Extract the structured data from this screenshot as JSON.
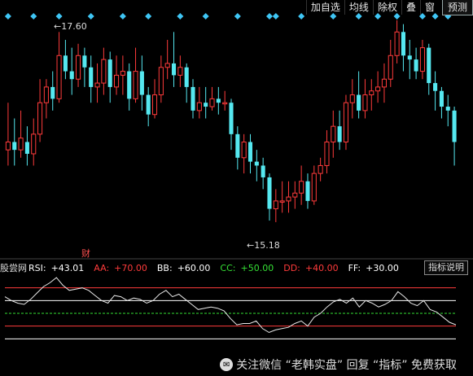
{
  "toolbar": {
    "items": [
      "加自选",
      "均线",
      "除权",
      "叠",
      "窗",
      "预测"
    ]
  },
  "price_chart": {
    "high_label": "17.60",
    "low_label": "15.18",
    "event_label": "财",
    "colors": {
      "up": "#ff3b3b",
      "down": "#55e8f0",
      "diamond": "#3fc6f5",
      "background": "#000000"
    }
  },
  "indicator": {
    "source": "股尝网",
    "items": [
      {
        "label": "RSI:",
        "value": "+43.01",
        "color": "#ffffff"
      },
      {
        "label": "AA:",
        "value": "+70.00",
        "color": "#ff3b3b"
      },
      {
        "label": "BB:",
        "value": "+60.00",
        "color": "#ffffff"
      },
      {
        "label": "CC:",
        "value": "+50.00",
        "color": "#35e035"
      },
      {
        "label": "DD:",
        "value": "+40.00",
        "color": "#ff3b3b"
      },
      {
        "label": "FF:",
        "value": "+30.00",
        "color": "#ffffff"
      }
    ],
    "button": "指标说明"
  },
  "watermark": "关注微信 “老韩实盘” 回复 “指标” 免费获取",
  "chart_data": {
    "type": "candlestick",
    "price_range": [
      14.9,
      17.8
    ],
    "high_marker": 17.6,
    "low_marker": 15.18,
    "candles": [
      [
        16.1,
        16.2,
        16.7,
        15.9
      ],
      [
        16.2,
        16.1,
        16.5,
        15.9
      ],
      [
        16.1,
        16.25,
        16.6,
        16.0
      ],
      [
        16.2,
        16.05,
        16.4,
        15.9
      ],
      [
        16.05,
        16.3,
        16.5,
        15.9
      ],
      [
        16.3,
        16.7,
        17.0,
        16.2
      ],
      [
        16.7,
        16.9,
        17.0,
        16.5
      ],
      [
        16.9,
        16.75,
        17.1,
        16.6
      ],
      [
        16.75,
        17.3,
        17.6,
        16.7
      ],
      [
        17.3,
        17.1,
        17.5,
        17.0
      ],
      [
        17.1,
        17.0,
        17.4,
        16.8
      ],
      [
        17.0,
        17.3,
        17.45,
        16.9
      ],
      [
        17.3,
        17.15,
        17.4,
        16.9
      ],
      [
        17.15,
        16.9,
        17.3,
        16.7
      ],
      [
        16.9,
        16.95,
        17.2,
        16.7
      ],
      [
        16.95,
        17.25,
        17.4,
        16.8
      ],
      [
        17.25,
        16.9,
        17.35,
        16.7
      ],
      [
        16.9,
        17.05,
        17.3,
        16.8
      ],
      [
        17.05,
        17.1,
        17.3,
        16.8
      ],
      [
        17.1,
        16.75,
        17.2,
        16.6
      ],
      [
        16.75,
        17.1,
        17.4,
        16.7
      ],
      [
        17.1,
        16.8,
        17.3,
        16.6
      ],
      [
        16.8,
        16.55,
        16.9,
        16.4
      ],
      [
        16.55,
        16.8,
        17.0,
        16.5
      ],
      [
        16.8,
        17.15,
        17.3,
        16.7
      ],
      [
        17.15,
        17.2,
        17.5,
        17.0
      ],
      [
        17.2,
        17.05,
        17.6,
        16.9
      ],
      [
        17.05,
        17.15,
        17.3,
        16.9
      ],
      [
        17.15,
        16.9,
        17.2,
        16.7
      ],
      [
        16.9,
        16.6,
        17.0,
        16.5
      ],
      [
        16.6,
        16.7,
        16.9,
        16.5
      ],
      [
        16.7,
        16.65,
        16.9,
        16.5
      ],
      [
        16.65,
        16.75,
        16.9,
        16.6
      ],
      [
        16.75,
        16.7,
        16.9,
        16.55
      ],
      [
        16.7,
        16.7,
        16.85,
        16.6
      ],
      [
        16.7,
        16.3,
        16.75,
        16.1
      ],
      [
        16.3,
        16.0,
        16.4,
        15.85
      ],
      [
        16.0,
        16.2,
        16.3,
        15.8
      ],
      [
        16.2,
        15.95,
        16.3,
        15.8
      ],
      [
        15.95,
        15.9,
        16.1,
        15.7
      ],
      [
        15.9,
        15.75,
        16.0,
        15.6
      ],
      [
        15.75,
        15.35,
        15.8,
        15.2
      ],
      [
        15.35,
        15.45,
        15.6,
        15.18
      ],
      [
        15.45,
        15.45,
        15.7,
        15.3
      ],
      [
        15.45,
        15.5,
        15.7,
        15.3
      ],
      [
        15.5,
        15.55,
        15.7,
        15.35
      ],
      [
        15.55,
        15.7,
        15.9,
        15.4
      ],
      [
        15.7,
        15.45,
        15.8,
        15.35
      ],
      [
        15.45,
        15.8,
        15.9,
        15.4
      ],
      [
        15.8,
        15.9,
        16.0,
        15.7
      ],
      [
        15.9,
        16.2,
        16.35,
        15.8
      ],
      [
        16.2,
        16.4,
        16.6,
        16.0
      ],
      [
        16.4,
        16.2,
        16.6,
        16.1
      ],
      [
        16.2,
        16.7,
        16.8,
        16.1
      ],
      [
        16.7,
        16.8,
        17.0,
        16.5
      ],
      [
        16.8,
        16.6,
        17.1,
        16.5
      ],
      [
        16.6,
        16.8,
        17.0,
        16.5
      ],
      [
        16.8,
        16.85,
        17.0,
        16.6
      ],
      [
        16.85,
        16.9,
        17.1,
        16.7
      ],
      [
        16.9,
        17.0,
        17.2,
        16.7
      ],
      [
        17.0,
        17.3,
        17.5,
        16.9
      ],
      [
        17.3,
        17.6,
        17.75,
        17.2
      ],
      [
        17.6,
        17.3,
        17.7,
        17.1
      ],
      [
        17.3,
        17.25,
        17.5,
        17.0
      ],
      [
        17.25,
        17.1,
        17.4,
        17.0
      ],
      [
        17.1,
        17.4,
        17.5,
        17.0
      ],
      [
        17.4,
        16.95,
        17.45,
        16.8
      ],
      [
        16.95,
        16.85,
        17.1,
        16.6
      ],
      [
        16.85,
        16.65,
        16.9,
        16.5
      ],
      [
        16.65,
        16.6,
        16.8,
        16.4
      ],
      [
        16.6,
        16.2,
        16.65,
        15.9
      ]
    ],
    "indicator_lines": {
      "AA": 70,
      "BB": 60,
      "CC": 50,
      "DD": 40,
      "FF": 30
    },
    "rsi": [
      63,
      60,
      58,
      57,
      61,
      66,
      71,
      74,
      78,
      72,
      68,
      69,
      70,
      68,
      64,
      60,
      58,
      64,
      63,
      60,
      62,
      61,
      58,
      60,
      65,
      68,
      63,
      65,
      61,
      57,
      53,
      54,
      55,
      54,
      52,
      46,
      41,
      42,
      42,
      44,
      38,
      35,
      37,
      38,
      39,
      42,
      44,
      40,
      47,
      50,
      55,
      59,
      61,
      58,
      62,
      55,
      60,
      58,
      55,
      57,
      60,
      67,
      63,
      58,
      56,
      60,
      53,
      51,
      47,
      43,
      41
    ]
  }
}
